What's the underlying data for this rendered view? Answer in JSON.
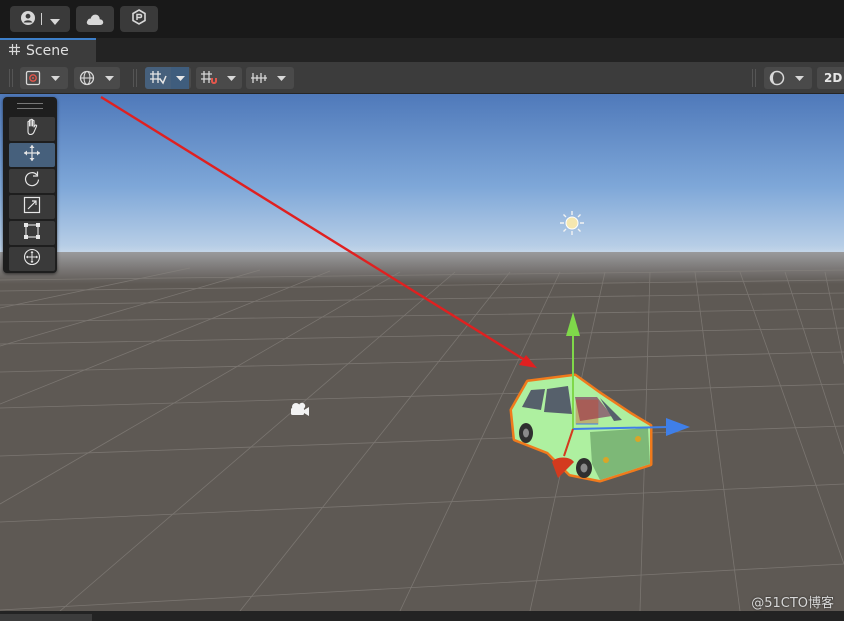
{
  "tab": {
    "label": "Scene"
  },
  "toolbar": {
    "mode_2d": "2D"
  },
  "watermark": {
    "text": "@51CTO博客"
  },
  "icons": {
    "account": "account-icon",
    "cloud": "cloud-icon",
    "collab": "collab-icon",
    "grid": "grid-icon",
    "hand": "hand-tool-icon",
    "move": "move-tool-icon",
    "rotate": "rotate-tool-icon",
    "scale": "scale-tool-icon",
    "rect": "rect-tool-icon",
    "transform": "transform-tool-icon",
    "light": "directional-light-icon",
    "camera": "camera-icon"
  },
  "colors": {
    "accent": "#3d7fc9",
    "selection_outline": "#f07a1c",
    "car_body": "#aef0a0",
    "gizmo_x": "#d43a1e",
    "gizmo_y": "#7fd84a",
    "gizmo_z": "#3f7fe8",
    "annotation_arrow": "#e02020"
  }
}
